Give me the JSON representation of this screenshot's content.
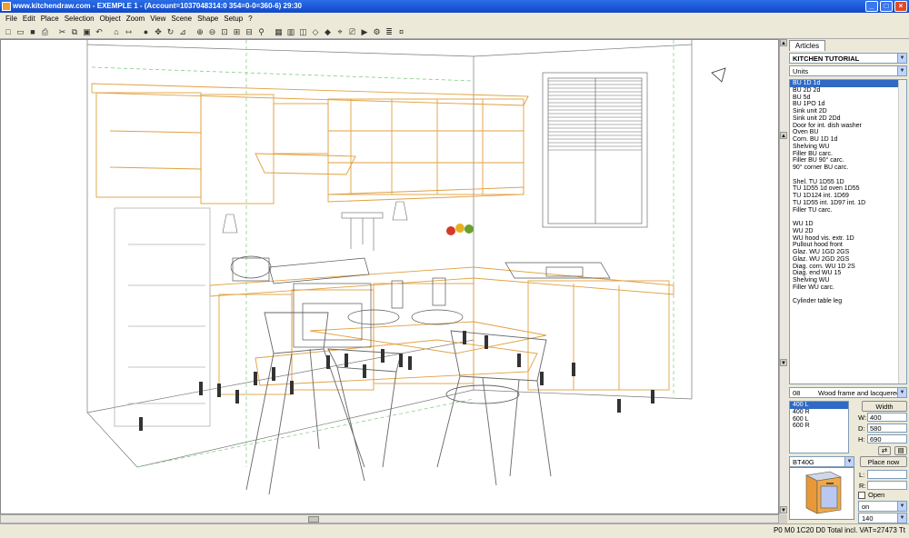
{
  "window": {
    "title": "www.kitchendraw.com - EXEMPLE 1 - (Account=1037048314:0 354=0-0=360-6) 29:30"
  },
  "menu": [
    "File",
    "Edit",
    "Place",
    "Selection",
    "Object",
    "Zoom",
    "View",
    "Scene",
    "Shape",
    "Setup",
    "?"
  ],
  "toolbar": {
    "icons": [
      "new-icon",
      "open-icon",
      "save-icon",
      "print-icon",
      "cut-icon",
      "copy-icon",
      "paste-icon",
      "undo-icon",
      "walls-icon",
      "dimension-icon",
      "info-icon",
      "move-icon",
      "rotate-icon",
      "elevation-icon",
      "zoom-in-icon",
      "zoom-out-icon",
      "zoom-window-icon",
      "zoom-all-icon",
      "zoom-prev-icon",
      "scene-icon",
      "view-plan-icon",
      "view-front-icon",
      "view-3d-icon",
      "view-wire-icon",
      "view-render-icon",
      "camera-icon",
      "photo-icon",
      "video-icon",
      "settings-icon",
      "report-icon",
      "price-icon"
    ]
  },
  "panel": {
    "tab": "Articles",
    "catalog": "KITCHEN TUTORIAL",
    "category": "Units",
    "articles": [
      "BU 1D 1d",
      "BU 2D 2d",
      "BU 5d",
      "BU 1PO 1d",
      "Sink unit 2D",
      "Sink unit 2D 2Dd",
      "Door for int. dish washer",
      "Oven BU",
      "Corn. BU 1D 1d",
      "Shelving WU",
      "Filler BU carc.",
      "Filler BU 90° carc.",
      "90° corner BU carc.",
      "",
      "Shel. TU 1D55 1D",
      "TU 1D55 1d oven 1D55",
      "TU 1D124 int. 1D69",
      "TU 1D55 int. 1D97 int. 1D",
      "Filler TU carc.",
      "",
      "WU 1D",
      "WU 2D",
      "WU hood vis. extr. 1D",
      "Pullout hood front",
      "Glaz. WU 1GD 2GS",
      "Glaz. WU 2GD 2GS",
      "Diag. corn. WU 1D 2S",
      "Diag. end WU 15",
      "Shelving WU",
      "Filler WU carc.",
      "",
      "Cylinder table leg"
    ],
    "finish_code": "08",
    "finish_name": "Wood frame and lacquered par",
    "sizes": [
      "400 L",
      "400 R",
      "600 L",
      "600 R"
    ],
    "width_button": "Width",
    "w_label": "W:",
    "w_value": "400",
    "d_label": "D:",
    "d_value": "580",
    "h_label": "H:",
    "h_value": "690",
    "ref": "BT40G",
    "place_button": "Place now",
    "l_label": "L:",
    "r_label": "R:",
    "open_label": "Open",
    "on_value": "on",
    "num_value": "140"
  },
  "status": "P0 M0 1C20 D0 Total incl. VAT=27473 Tt"
}
